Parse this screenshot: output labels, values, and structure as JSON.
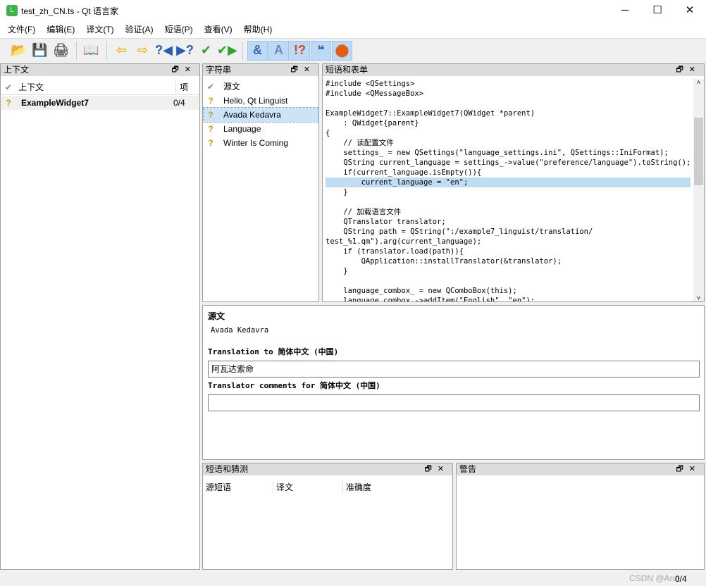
{
  "window": {
    "title": "test_zh_CN.ts - Qt 语言家",
    "icon_letter": "L",
    "minimize": "─",
    "maximize": "☐",
    "close": "✕"
  },
  "menu": [
    "文件(F)",
    "编辑(E)",
    "译文(T)",
    "验证(A)",
    "短语(P)",
    "查看(V)",
    "帮助(H)"
  ],
  "toolbar": {
    "icons": [
      "open-icon",
      "save-icon",
      "print-icon",
      "phrasebook-icon",
      "prev-icon",
      "next-icon",
      "prev-unfinished-icon",
      "next-unfinished-icon",
      "done-icon",
      "done-next-icon",
      "accelerator-check-icon",
      "punctuation-check-icon",
      "phrase-check-icon",
      "placeholder-check-icon",
      "surrounding-whitespace-check-icon"
    ],
    "glyphs": [
      "📂",
      "💾",
      "🖨",
      "📖",
      "⇦",
      "⇨",
      "?◀",
      "▶?",
      "✔",
      "✔▶",
      "&",
      "A",
      "!?",
      "❝",
      "⬤"
    ]
  },
  "context": {
    "title": "上下文",
    "columns": [
      "上下文",
      "项"
    ],
    "rows": [
      {
        "name": "ExampleWidget7",
        "count": "0/4",
        "status": "?"
      }
    ]
  },
  "strings": {
    "title": "字符串",
    "header": "源文",
    "items": [
      {
        "text": "Hello, Qt Linguist",
        "status": "?"
      },
      {
        "text": "Avada Kedavra",
        "status": "?",
        "selected": true
      },
      {
        "text": "Language",
        "status": "?"
      },
      {
        "text": "Winter Is Coming",
        "status": "?"
      }
    ]
  },
  "sources": {
    "title": "短语和表单",
    "lines": [
      "#include <QSettings>",
      "#include <QMessageBox>",
      "",
      "ExampleWidget7::ExampleWidget7(QWidget *parent)",
      "    : QWidget{parent}",
      "{",
      "    // 读配置文件",
      "    settings_ = new QSettings(\"language_settings.ini\", QSettings::IniFormat);",
      "    QString current_language = settings_->value(\"preference/language\").toString();",
      "    if(current_language.isEmpty()){",
      "        current_language = \"en\";",
      "    }",
      "",
      "    // 加载语言文件",
      "    QTranslator translator;",
      "    QString path = QString(\":/example7_linguist/translation/",
      "test_%1.qm\").arg(current_language);",
      "    if (translator.load(path)){",
      "        QApplication::installTranslator(&translator);",
      "    }",
      "",
      "    language_combox_ = new QComboBox(this);",
      "    language_combox_->addItem(\"English\", \"en\");"
    ],
    "highlight_line": 10
  },
  "editor": {
    "source_label": "源文",
    "source_text": "Avada Kedavra",
    "translation_label": "Translation to 简体中文 (中国)",
    "translation_value": "阿瓦达索命",
    "comments_label": "Translator comments for 简体中文 (中国)",
    "comments_value": ""
  },
  "phrases": {
    "title": "短语和猜测",
    "columns": [
      "源短语",
      "译文",
      "准确度"
    ]
  },
  "warnings": {
    "title": "警告"
  },
  "status": {
    "progress": "0/4",
    "watermark": "CSDN @Arui"
  },
  "colors": {
    "selection": "#c0dcf3",
    "toolbar_active": "#bcd9f5",
    "unfinished": "#c8a000"
  }
}
